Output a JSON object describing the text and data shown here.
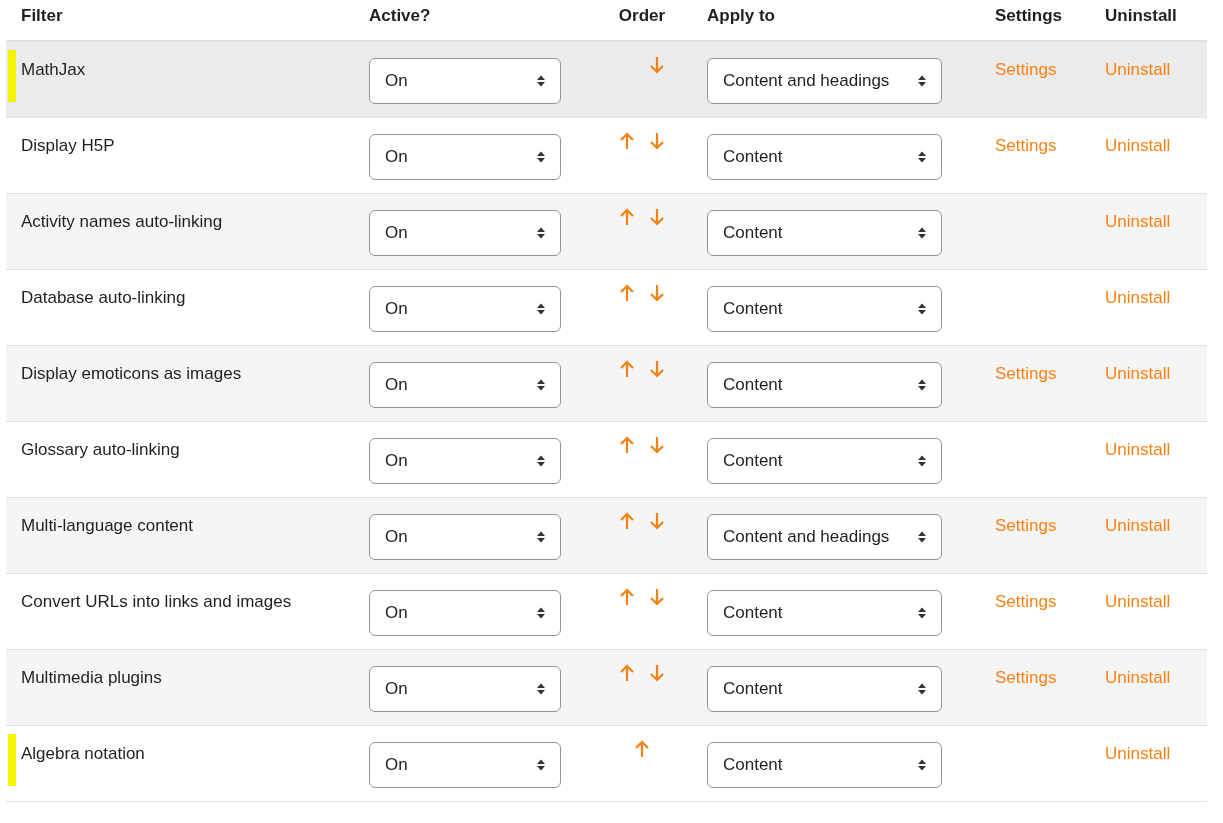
{
  "columns": [
    "Filter",
    "Active?",
    "Order",
    "Apply to",
    "Settings",
    "Uninstall"
  ],
  "rows": [
    {
      "name": "MathJax",
      "active": "On",
      "up": false,
      "down": true,
      "apply_to": "Content and headings",
      "settings": "Settings",
      "uninstall": "Uninstall",
      "marked": true,
      "highlighted": true
    },
    {
      "name": "Display H5P",
      "active": "On",
      "up": true,
      "down": true,
      "apply_to": "Content",
      "settings": "Settings",
      "uninstall": "Uninstall",
      "marked": false,
      "highlighted": false
    },
    {
      "name": "Activity names auto-linking",
      "active": "On",
      "up": true,
      "down": true,
      "apply_to": "Content",
      "uninstall": "Uninstall",
      "marked": false,
      "highlighted": false
    },
    {
      "name": "Database auto-linking",
      "active": "On",
      "up": true,
      "down": true,
      "apply_to": "Content",
      "uninstall": "Uninstall",
      "marked": false,
      "highlighted": false
    },
    {
      "name": "Display emoticons as images",
      "active": "On",
      "up": true,
      "down": true,
      "apply_to": "Content",
      "settings": "Settings",
      "uninstall": "Uninstall",
      "marked": false,
      "highlighted": false
    },
    {
      "name": "Glossary auto-linking",
      "active": "On",
      "up": true,
      "down": true,
      "apply_to": "Content",
      "uninstall": "Uninstall",
      "marked": false,
      "highlighted": false
    },
    {
      "name": "Multi-language content",
      "active": "On",
      "up": true,
      "down": true,
      "apply_to": "Content and headings",
      "settings": "Settings",
      "uninstall": "Uninstall",
      "marked": false,
      "highlighted": false
    },
    {
      "name": "Convert URLs into links and images",
      "active": "On",
      "up": true,
      "down": true,
      "apply_to": "Content",
      "settings": "Settings",
      "uninstall": "Uninstall",
      "marked": false,
      "highlighted": false
    },
    {
      "name": "Multimedia plugins",
      "active": "On",
      "up": true,
      "down": true,
      "apply_to": "Content",
      "settings": "Settings",
      "uninstall": "Uninstall",
      "marked": false,
      "highlighted": false
    },
    {
      "name": "Algebra notation",
      "active": "On",
      "up": true,
      "down": false,
      "apply_to": "Content",
      "uninstall": "Uninstall",
      "marked": true,
      "highlighted": false
    }
  ]
}
